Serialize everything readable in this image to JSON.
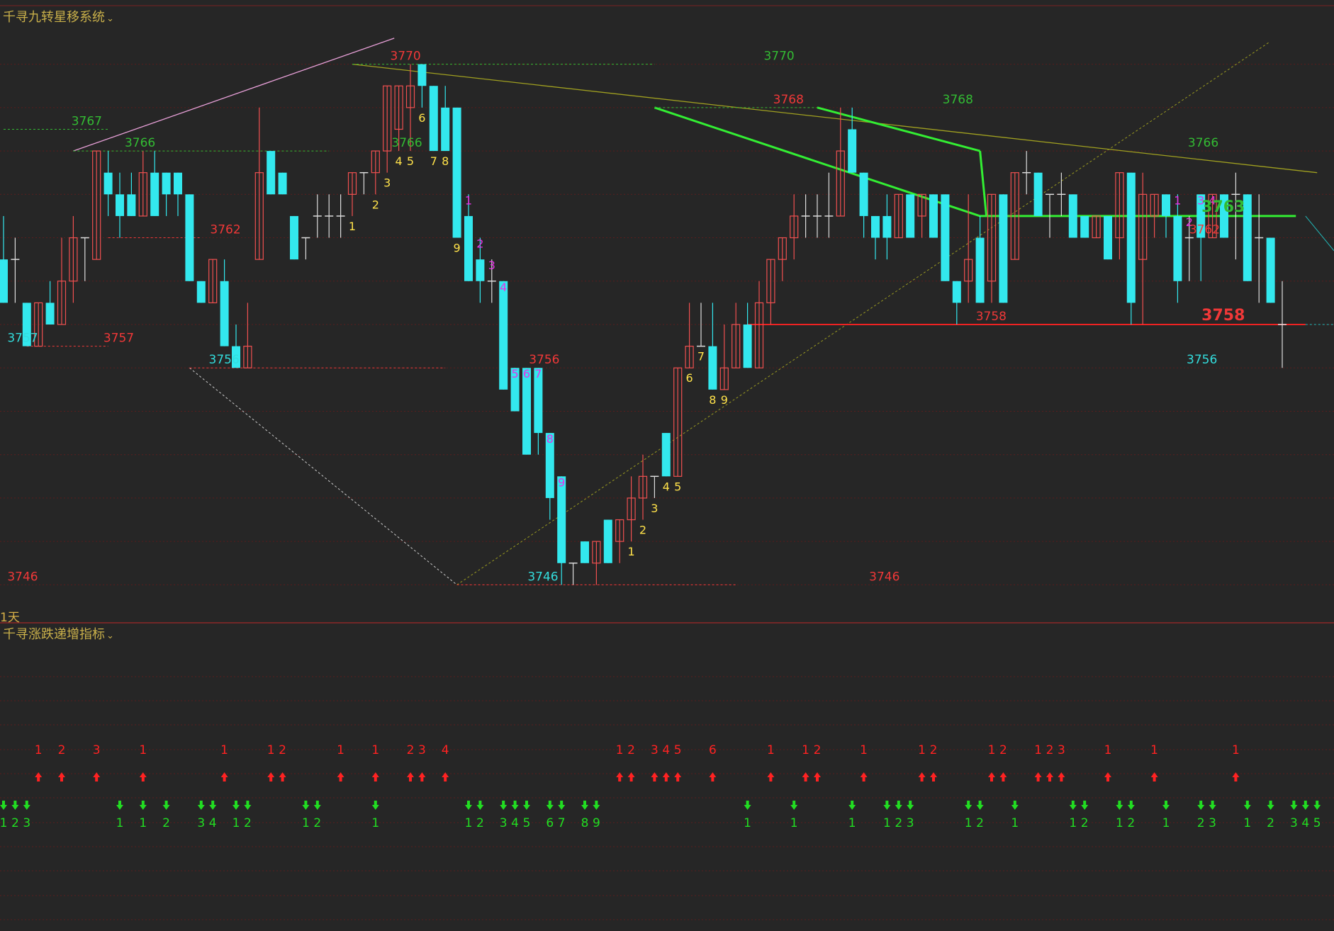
{
  "header": {
    "main_indicator": "千寻九转星移系统",
    "sub_indicator": "千寻涨跌递增指标",
    "period_label": "1天"
  },
  "colors": {
    "background": "#262626",
    "up_candle": "#f05050",
    "down_candle": "#33e8ee",
    "doji": "#dddddd",
    "setup_buy": "#ffe24a",
    "setup_sell": "#e632e6",
    "up_arrow": "#ff2222",
    "down_arrow": "#22dd22",
    "level_red": "#f03838",
    "level_green": "#33bb33",
    "level_cyan": "#33dddd",
    "grid": "#5a1e1e",
    "resist_line": "#33ee33",
    "support_line": "#ee2222"
  },
  "chart_data": {
    "type": "candlestick",
    "ylim": [
      3745,
      3771
    ],
    "yticks": [
      3746,
      3748,
      3750,
      3752,
      3754,
      3756,
      3758,
      3760,
      3762,
      3764,
      3766,
      3768,
      3770
    ],
    "candles": [
      {
        "o": 3761,
        "h": 3763,
        "l": 3759,
        "c": 3759
      },
      {
        "o": 3761,
        "h": 3762,
        "l": 3759,
        "c": 3761
      },
      {
        "o": 3759,
        "h": 3759,
        "l": 3757,
        "c": 3757
      },
      {
        "o": 3757,
        "h": 3759,
        "l": 3757,
        "c": 3759
      },
      {
        "o": 3759,
        "h": 3760,
        "l": 3758,
        "c": 3758
      },
      {
        "o": 3758,
        "h": 3762,
        "l": 3758,
        "c": 3760
      },
      {
        "o": 3760,
        "h": 3763,
        "l": 3759,
        "c": 3762
      },
      {
        "o": 3762,
        "h": 3762,
        "l": 3760,
        "c": 3762
      },
      {
        "o": 3761,
        "h": 3766,
        "l": 3761,
        "c": 3766
      },
      {
        "o": 3765,
        "h": 3766,
        "l": 3763,
        "c": 3764
      },
      {
        "o": 3764,
        "h": 3765,
        "l": 3762,
        "c": 3763
      },
      {
        "o": 3764,
        "h": 3765,
        "l": 3763,
        "c": 3763
      },
      {
        "o": 3763,
        "h": 3766,
        "l": 3763,
        "c": 3765
      },
      {
        "o": 3765,
        "h": 3766,
        "l": 3763,
        "c": 3763
      },
      {
        "o": 3765,
        "h": 3765,
        "l": 3763,
        "c": 3764
      },
      {
        "o": 3765,
        "h": 3765,
        "l": 3763,
        "c": 3764
      },
      {
        "o": 3764,
        "h": 3764,
        "l": 3760,
        "c": 3760
      },
      {
        "o": 3760,
        "h": 3760,
        "l": 3759,
        "c": 3759
      },
      {
        "o": 3759,
        "h": 3761,
        "l": 3759,
        "c": 3761
      },
      {
        "o": 3760,
        "h": 3761,
        "l": 3757,
        "c": 3757
      },
      {
        "o": 3757,
        "h": 3758,
        "l": 3756,
        "c": 3756
      },
      {
        "o": 3756,
        "h": 3759,
        "l": 3756,
        "c": 3757
      },
      {
        "o": 3761,
        "h": 3768,
        "l": 3761,
        "c": 3765
      },
      {
        "o": 3766,
        "h": 3766,
        "l": 3764,
        "c": 3764
      },
      {
        "o": 3765,
        "h": 3765,
        "l": 3764,
        "c": 3764
      },
      {
        "o": 3763,
        "h": 3763,
        "l": 3761,
        "c": 3761
      },
      {
        "o": 3762,
        "h": 3762,
        "l": 3761,
        "c": 3762
      },
      {
        "o": 3763,
        "h": 3764,
        "l": 3762,
        "c": 3763
      },
      {
        "o": 3763,
        "h": 3764,
        "l": 3762,
        "c": 3763
      },
      {
        "o": 3763,
        "h": 3764,
        "l": 3762,
        "c": 3763
      },
      {
        "o": 3764,
        "h": 3765,
        "l": 3763,
        "c": 3765
      },
      {
        "o": 3765,
        "h": 3765,
        "l": 3764,
        "c": 3765
      },
      {
        "o": 3765,
        "h": 3766,
        "l": 3764,
        "c": 3766
      },
      {
        "o": 3766,
        "h": 3769,
        "l": 3765,
        "c": 3769
      },
      {
        "o": 3767,
        "h": 3769,
        "l": 3766,
        "c": 3769
      },
      {
        "o": 3768,
        "h": 3770,
        "l": 3766,
        "c": 3769
      },
      {
        "o": 3770,
        "h": 3770,
        "l": 3768,
        "c": 3769
      },
      {
        "o": 3769,
        "h": 3769,
        "l": 3766,
        "c": 3766
      },
      {
        "o": 3768,
        "h": 3769,
        "l": 3766,
        "c": 3766
      },
      {
        "o": 3768,
        "h": 3768,
        "l": 3762,
        "c": 3762
      },
      {
        "o": 3763,
        "h": 3764,
        "l": 3760,
        "c": 3760
      },
      {
        "o": 3761,
        "h": 3762,
        "l": 3759,
        "c": 3760
      },
      {
        "o": 3760,
        "h": 3761,
        "l": 3759,
        "c": 3760
      },
      {
        "o": 3760,
        "h": 3760,
        "l": 3755,
        "c": 3755
      },
      {
        "o": 3756,
        "h": 3756,
        "l": 3754,
        "c": 3754
      },
      {
        "o": 3756,
        "h": 3756,
        "l": 3752,
        "c": 3752
      },
      {
        "o": 3756,
        "h": 3756,
        "l": 3752,
        "c": 3753
      },
      {
        "o": 3753,
        "h": 3753,
        "l": 3749,
        "c": 3750
      },
      {
        "o": 3751,
        "h": 3751,
        "l": 3746,
        "c": 3747
      },
      {
        "o": 3747,
        "h": 3747,
        "l": 3746,
        "c": 3747
      },
      {
        "o": 3748,
        "h": 3748,
        "l": 3747,
        "c": 3747
      },
      {
        "o": 3747,
        "h": 3748,
        "l": 3746,
        "c": 3748
      },
      {
        "o": 3749,
        "h": 3749,
        "l": 3747,
        "c": 3747
      },
      {
        "o": 3748,
        "h": 3749,
        "l": 3747,
        "c": 3749
      },
      {
        "o": 3749,
        "h": 3751,
        "l": 3748,
        "c": 3750
      },
      {
        "o": 3750,
        "h": 3752,
        "l": 3749,
        "c": 3751
      },
      {
        "o": 3751,
        "h": 3751,
        "l": 3750,
        "c": 3751
      },
      {
        "o": 3753,
        "h": 3753,
        "l": 3751,
        "c": 3751
      },
      {
        "o": 3751,
        "h": 3756,
        "l": 3751,
        "c": 3756
      },
      {
        "o": 3756,
        "h": 3759,
        "l": 3756,
        "c": 3757
      },
      {
        "o": 3757,
        "h": 3759,
        "l": 3757,
        "c": 3757
      },
      {
        "o": 3757,
        "h": 3759,
        "l": 3755,
        "c": 3755
      },
      {
        "o": 3755,
        "h": 3758,
        "l": 3755,
        "c": 3756
      },
      {
        "o": 3756,
        "h": 3759,
        "l": 3756,
        "c": 3758
      },
      {
        "o": 3758,
        "h": 3759,
        "l": 3756,
        "c": 3756
      },
      {
        "o": 3756,
        "h": 3760,
        "l": 3756,
        "c": 3759
      },
      {
        "o": 3759,
        "h": 3761,
        "l": 3758,
        "c": 3761
      },
      {
        "o": 3761,
        "h": 3762,
        "l": 3760,
        "c": 3762
      },
      {
        "o": 3762,
        "h": 3764,
        "l": 3761,
        "c": 3763
      },
      {
        "o": 3763,
        "h": 3764,
        "l": 3762,
        "c": 3763
      },
      {
        "o": 3763,
        "h": 3764,
        "l": 3762,
        "c": 3763
      },
      {
        "o": 3763,
        "h": 3765,
        "l": 3762,
        "c": 3763
      },
      {
        "o": 3763,
        "h": 3768,
        "l": 3763,
        "c": 3766
      },
      {
        "o": 3767,
        "h": 3768,
        "l": 3765,
        "c": 3765
      },
      {
        "o": 3765,
        "h": 3765,
        "l": 3762,
        "c": 3763
      },
      {
        "o": 3763,
        "h": 3763,
        "l": 3761,
        "c": 3762
      },
      {
        "o": 3763,
        "h": 3764,
        "l": 3761,
        "c": 3762
      },
      {
        "o": 3762,
        "h": 3764,
        "l": 3762,
        "c": 3764
      },
      {
        "o": 3764,
        "h": 3764,
        "l": 3762,
        "c": 3762
      },
      {
        "o": 3763,
        "h": 3764,
        "l": 3762,
        "c": 3764
      },
      {
        "o": 3764,
        "h": 3764,
        "l": 3762,
        "c": 3762
      },
      {
        "o": 3764,
        "h": 3764,
        "l": 3760,
        "c": 3760
      },
      {
        "o": 3760,
        "h": 3760,
        "l": 3758,
        "c": 3759
      },
      {
        "o": 3760,
        "h": 3764,
        "l": 3759,
        "c": 3761
      },
      {
        "o": 3762,
        "h": 3763,
        "l": 3759,
        "c": 3759
      },
      {
        "o": 3760,
        "h": 3764,
        "l": 3759,
        "c": 3764
      },
      {
        "o": 3764,
        "h": 3764,
        "l": 3759,
        "c": 3759
      },
      {
        "o": 3761,
        "h": 3765,
        "l": 3761,
        "c": 3765
      },
      {
        "o": 3765,
        "h": 3766,
        "l": 3764,
        "c": 3765
      },
      {
        "o": 3765,
        "h": 3765,
        "l": 3763,
        "c": 3763
      },
      {
        "o": 3764,
        "h": 3764,
        "l": 3762,
        "c": 3764
      },
      {
        "o": 3764,
        "h": 3765,
        "l": 3763,
        "c": 3764
      },
      {
        "o": 3764,
        "h": 3764,
        "l": 3762,
        "c": 3762
      },
      {
        "o": 3763,
        "h": 3763,
        "l": 3762,
        "c": 3762
      },
      {
        "o": 3762,
        "h": 3763,
        "l": 3762,
        "c": 3763
      },
      {
        "o": 3763,
        "h": 3763,
        "l": 3761,
        "c": 3761
      },
      {
        "o": 3762,
        "h": 3765,
        "l": 3761,
        "c": 3765
      },
      {
        "o": 3765,
        "h": 3765,
        "l": 3758,
        "c": 3759
      },
      {
        "o": 3761,
        "h": 3765,
        "l": 3758,
        "c": 3764
      },
      {
        "o": 3763,
        "h": 3764,
        "l": 3762,
        "c": 3764
      },
      {
        "o": 3764,
        "h": 3764,
        "l": 3762,
        "c": 3763
      },
      {
        "o": 3763,
        "h": 3764,
        "l": 3759,
        "c": 3760
      },
      {
        "o": 3762,
        "h": 3763,
        "l": 3760,
        "c": 3762
      },
      {
        "o": 3764,
        "h": 3764,
        "l": 3760,
        "c": 3762
      },
      {
        "o": 3762,
        "h": 3764,
        "l": 3762,
        "c": 3764
      },
      {
        "o": 3764,
        "h": 3764,
        "l": 3762,
        "c": 3762
      },
      {
        "o": 3764,
        "h": 3765,
        "l": 3761,
        "c": 3764
      },
      {
        "o": 3764,
        "h": 3764,
        "l": 3760,
        "c": 3760
      },
      {
        "o": 3762,
        "h": 3764,
        "l": 3759,
        "c": 3762
      },
      {
        "o": 3762,
        "h": 3762,
        "l": 3759,
        "c": 3759
      },
      {
        "o": 3758,
        "h": 3760,
        "l": 3756,
        "c": 3758
      }
    ],
    "setup_numbers": [
      {
        "i": 30,
        "t": "1",
        "k": "buy"
      },
      {
        "i": 32,
        "t": "2",
        "k": "buy"
      },
      {
        "i": 33,
        "t": "3",
        "k": "buy"
      },
      {
        "i": 34,
        "t": "4",
        "k": "buy"
      },
      {
        "i": 35,
        "t": "5",
        "k": "buy"
      },
      {
        "i": 36,
        "t": "6",
        "k": "buy"
      },
      {
        "i": 37,
        "t": "7",
        "k": "buy"
      },
      {
        "i": 38,
        "t": "8",
        "k": "buy"
      },
      {
        "i": 39,
        "t": "9",
        "k": "buy"
      },
      {
        "i": 40,
        "t": "1",
        "k": "sell"
      },
      {
        "i": 41,
        "t": "2",
        "k": "sell"
      },
      {
        "i": 42,
        "t": "3",
        "k": "sell"
      },
      {
        "i": 43,
        "t": "4",
        "k": "sell"
      },
      {
        "i": 44,
        "t": "5",
        "k": "sell"
      },
      {
        "i": 45,
        "t": "6",
        "k": "sell"
      },
      {
        "i": 46,
        "t": "7",
        "k": "sell"
      },
      {
        "i": 47,
        "t": "8",
        "k": "sell"
      },
      {
        "i": 48,
        "t": "9",
        "k": "sell"
      },
      {
        "i": 54,
        "t": "1",
        "k": "buy"
      },
      {
        "i": 55,
        "t": "2",
        "k": "buy"
      },
      {
        "i": 56,
        "t": "3",
        "k": "buy"
      },
      {
        "i": 57,
        "t": "4",
        "k": "buy"
      },
      {
        "i": 58,
        "t": "5",
        "k": "buy"
      },
      {
        "i": 59,
        "t": "6",
        "k": "buy"
      },
      {
        "i": 60,
        "t": "7",
        "k": "buy"
      },
      {
        "i": 61,
        "t": "8",
        "k": "buy"
      },
      {
        "i": 62,
        "t": "9",
        "k": "buy"
      },
      {
        "i": 101,
        "t": "1",
        "k": "sell"
      },
      {
        "i": 102,
        "t": "2",
        "k": "sell"
      },
      {
        "i": 103,
        "t": "3",
        "k": "sell"
      },
      {
        "i": 104,
        "t": "4",
        "k": "sell"
      }
    ],
    "price_labels": [
      {
        "t": "3770",
        "v": 3770,
        "x": 0.304,
        "c": "red"
      },
      {
        "t": "3770",
        "v": 3770,
        "x": 0.584,
        "c": "green"
      },
      {
        "t": "3768",
        "v": 3768,
        "x": 0.591,
        "c": "red"
      },
      {
        "t": "3768",
        "v": 3768,
        "x": 0.718,
        "c": "green"
      },
      {
        "t": "3767",
        "v": 3767,
        "x": 0.065,
        "c": "green"
      },
      {
        "t": "3766",
        "v": 3766,
        "x": 0.105,
        "c": "green"
      },
      {
        "t": "3766",
        "v": 3766,
        "x": 0.305,
        "c": "green"
      },
      {
        "t": "3766",
        "v": 3766,
        "x": 0.902,
        "c": "green"
      },
      {
        "t": "3763",
        "v": 3763,
        "x": 0.917,
        "c": "green",
        "big": true
      },
      {
        "t": "3762",
        "v": 3762,
        "x": 0.169,
        "c": "red"
      },
      {
        "t": "3762",
        "v": 3762,
        "x": 0.903,
        "c": "red"
      },
      {
        "t": "3758",
        "v": 3758,
        "x": 0.743,
        "c": "red"
      },
      {
        "t": "3758",
        "v": 3758,
        "x": 0.917,
        "c": "red",
        "big": true
      },
      {
        "t": "3757",
        "v": 3757,
        "x": 0.017,
        "c": "cyan"
      },
      {
        "t": "3757",
        "v": 3757,
        "x": 0.089,
        "c": "red"
      },
      {
        "t": "3756",
        "v": 3756,
        "x": 0.168,
        "c": "cyan"
      },
      {
        "t": "3756",
        "v": 3756,
        "x": 0.408,
        "c": "red"
      },
      {
        "t": "3756",
        "v": 3756,
        "x": 0.901,
        "c": "cyan"
      },
      {
        "t": "3746",
        "v": 3746,
        "x": 0.017,
        "c": "red"
      },
      {
        "t": "3746",
        "v": 3746,
        "x": 0.407,
        "c": "cyan"
      },
      {
        "t": "3746",
        "v": 3746,
        "x": 0.663,
        "c": "red"
      }
    ],
    "arrow_signals": {
      "up": [
        {
          "i": 3,
          "t": "1"
        },
        {
          "i": 5,
          "t": "2"
        },
        {
          "i": 8,
          "t": "3"
        },
        {
          "i": 12,
          "t": "1"
        },
        {
          "i": 19,
          "t": "1"
        },
        {
          "i": 23,
          "t": "1"
        },
        {
          "i": 24,
          "t": "2"
        },
        {
          "i": 29,
          "t": "1"
        },
        {
          "i": 32,
          "t": "1"
        },
        {
          "i": 35,
          "t": "2"
        },
        {
          "i": 36,
          "t": "3"
        },
        {
          "i": 38,
          "t": "4"
        },
        {
          "i": 53,
          "t": "1"
        },
        {
          "i": 54,
          "t": "2"
        },
        {
          "i": 56,
          "t": "3"
        },
        {
          "i": 57,
          "t": "4"
        },
        {
          "i": 58,
          "t": "5"
        },
        {
          "i": 61,
          "t": "6"
        },
        {
          "i": 66,
          "t": "1"
        },
        {
          "i": 69,
          "t": "1"
        },
        {
          "i": 70,
          "t": "2"
        },
        {
          "i": 74,
          "t": "1"
        },
        {
          "i": 79,
          "t": "1"
        },
        {
          "i": 80,
          "t": "2"
        },
        {
          "i": 85,
          "t": "1"
        },
        {
          "i": 86,
          "t": "2"
        },
        {
          "i": 89,
          "t": "1"
        },
        {
          "i": 90,
          "t": "2"
        },
        {
          "i": 91,
          "t": "3"
        },
        {
          "i": 95,
          "t": "1"
        },
        {
          "i": 99,
          "t": "1"
        },
        {
          "i": 106,
          "t": "1"
        }
      ],
      "down": [
        {
          "i": 0,
          "t": "1"
        },
        {
          "i": 1,
          "t": "2"
        },
        {
          "i": 2,
          "t": "3"
        },
        {
          "i": 10,
          "t": "1"
        },
        {
          "i": 12,
          "t": "1"
        },
        {
          "i": 14,
          "t": "2"
        },
        {
          "i": 17,
          "t": "3"
        },
        {
          "i": 18,
          "t": "4"
        },
        {
          "i": 20,
          "t": "1"
        },
        {
          "i": 21,
          "t": "2"
        },
        {
          "i": 26,
          "t": "1"
        },
        {
          "i": 27,
          "t": "2"
        },
        {
          "i": 32,
          "t": "1"
        },
        {
          "i": 40,
          "t": "1"
        },
        {
          "i": 41,
          "t": "2"
        },
        {
          "i": 43,
          "t": "3"
        },
        {
          "i": 44,
          "t": "4"
        },
        {
          "i": 45,
          "t": "5"
        },
        {
          "i": 47,
          "t": "6"
        },
        {
          "i": 48,
          "t": "7"
        },
        {
          "i": 50,
          "t": "8"
        },
        {
          "i": 51,
          "t": "9"
        },
        {
          "i": 64,
          "t": "1"
        },
        {
          "i": 68,
          "t": "1"
        },
        {
          "i": 73,
          "t": "1"
        },
        {
          "i": 76,
          "t": "1"
        },
        {
          "i": 77,
          "t": "2"
        },
        {
          "i": 78,
          "t": "3"
        },
        {
          "i": 83,
          "t": "1"
        },
        {
          "i": 84,
          "t": "2"
        },
        {
          "i": 87,
          "t": "1"
        },
        {
          "i": 92,
          "t": "1"
        },
        {
          "i": 93,
          "t": "2"
        },
        {
          "i": 96,
          "t": "1"
        },
        {
          "i": 97,
          "t": "2"
        },
        {
          "i": 100,
          "t": "1"
        },
        {
          "i": 103,
          "t": "2"
        },
        {
          "i": 104,
          "t": "3"
        },
        {
          "i": 107,
          "t": "1"
        },
        {
          "i": 109,
          "t": "2"
        },
        {
          "i": 111,
          "t": "3"
        },
        {
          "i": 112,
          "t": "4"
        },
        {
          "i": 113,
          "t": "5"
        }
      ]
    }
  }
}
